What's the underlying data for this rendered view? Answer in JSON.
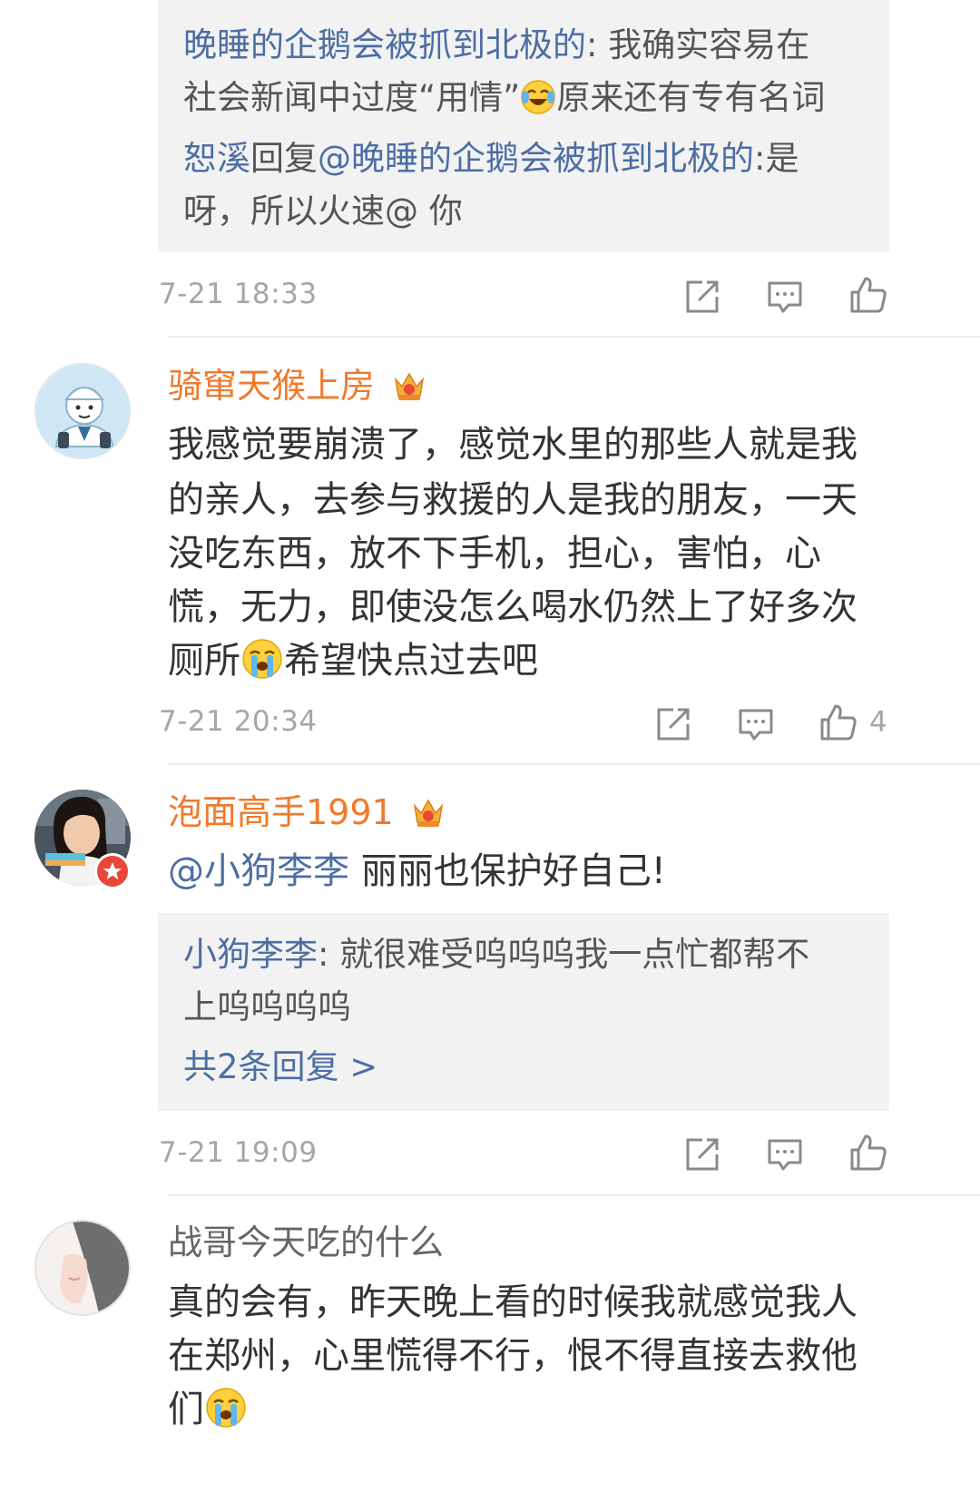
{
  "comment0": {
    "reply1_user": "晚睡的企鹅会被抓到北极的",
    "reply1_sep": ": ",
    "reply1_text_a": "我确实容易在",
    "reply1_line2_a": "社会新闻中过度“用情”",
    "reply1_line2_b": "原来还有专有名词",
    "reply2_user": "恕溪",
    "reply2_verb": "回复",
    "reply2_mention": "@晚睡的企鹅会被抓到北极的",
    "reply2_text_a": ":是",
    "reply2_line2": "呀，所以火速@ 你",
    "time": "7-21 18:33"
  },
  "comment1": {
    "username": "骑窜天猴上房",
    "lines": [
      "我感觉要崩溃了，感觉水里的那些人就是我",
      "的亲人，去参与救援的人是我的朋友，一天",
      "没吃东西，放不下手机，担心，害怕，心",
      "慌，无力，即使没怎么喝水仍然上了好多次"
    ],
    "line5_a": "厕所",
    "line5_b": "希望快点过去吧",
    "time": "7-21 20:34",
    "likes": "4"
  },
  "comment2": {
    "username": "泡面高手1991",
    "mention": "@小狗李李",
    "text": " 丽丽也保护好自己!",
    "reply_user": "小狗李李",
    "reply_sep": ": ",
    "reply_text_a": "就很难受呜呜呜我一点忙都帮不",
    "reply_line2": "上呜呜呜呜",
    "more_replies": "共2条回复 >",
    "time": "7-21 19:09"
  },
  "comment3": {
    "username": "战哥今天吃的什么",
    "lines": [
      "真的会有，昨天晚上看的时候我就感觉我人",
      "在郑州，心里慌得不行，恨不得直接去救他"
    ],
    "line3": "们"
  },
  "icons": {
    "share": "share-icon",
    "comment": "comment-icon",
    "like": "thumbs-up-icon",
    "crown": "vip-crown-icon",
    "laugh_cry": "laughing-crying-emoji",
    "cry": "crying-emoji"
  },
  "colors": {
    "link_blue": "#4d6ea3",
    "vip_orange": "#f1792b",
    "meta_gray": "#a6a6a6",
    "reply_bg": "#f2f2f2"
  }
}
